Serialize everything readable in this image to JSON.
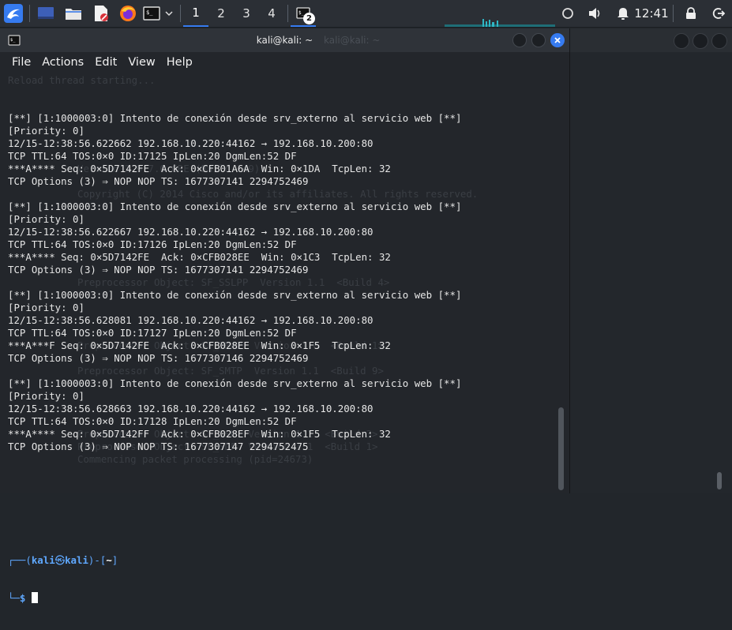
{
  "taskbar": {
    "workspaces": [
      "1",
      "2",
      "3",
      "4"
    ],
    "active_workspace": 0,
    "terminal_task_count": "2",
    "clock": "12:41"
  },
  "window": {
    "title": "kali@kali: ~",
    "background_title": "kali@kali: ~"
  },
  "menu": [
    "File",
    "Actions",
    "Edit",
    "View",
    "Help"
  ],
  "terminal": {
    "lines": [
      "[**] [1:1000003:0] Intento de conexión desde srv_externo al servicio web [**]",
      "[Priority: 0]",
      "12/15-12:38:56.622662 192.168.10.220:44162 → 192.168.10.200:80",
      "TCP TTL:64 TOS:0×0 ID:17125 IpLen:20 DgmLen:52 DF",
      "***A**** Seq: 0×5D7142FE  Ack: 0×CFB01A6A  Win: 0×1DA  TcpLen: 32",
      "TCP Options (3) ⇒ NOP NOP TS: 1677307141 2294752469",
      "",
      "[**] [1:1000003:0] Intento de conexión desde srv_externo al servicio web [**]",
      "[Priority: 0]",
      "12/15-12:38:56.622667 192.168.10.220:44162 → 192.168.10.200:80",
      "TCP TTL:64 TOS:0×0 ID:17126 IpLen:20 DgmLen:52 DF",
      "***A**** Seq: 0×5D7142FE  Ack: 0×CFB028EE  Win: 0×1C3  TcpLen: 32",
      "TCP Options (3) ⇒ NOP NOP TS: 1677307141 2294752469",
      "",
      "[**] [1:1000003:0] Intento de conexión desde srv_externo al servicio web [**]",
      "[Priority: 0]",
      "12/15-12:38:56.628081 192.168.10.220:44162 → 192.168.10.200:80",
      "TCP TTL:64 TOS:0×0 ID:17127 IpLen:20 DgmLen:52 DF",
      "***A***F Seq: 0×5D7142FE  Ack: 0×CFB028EE  Win: 0×1F5  TcpLen: 32",
      "TCP Options (3) ⇒ NOP NOP TS: 1677307146 2294752469",
      "",
      "[**] [1:1000003:0] Intento de conexión desde srv_externo al servicio web [**]",
      "[Priority: 0]",
      "12/15-12:38:56.628663 192.168.10.220:44162 → 192.168.10.200:80",
      "TCP TTL:64 TOS:0×0 ID:17128 IpLen:20 DgmLen:52 DF",
      "***A**** Seq: 0×5D7142FF  Ack: 0×CFB028EF  Win: 0×1F5  TcpLen: 32",
      "TCP Options (3) ⇒ NOP NOP TS: 1677307147 2294752475"
    ],
    "prompt": {
      "open": "┌──(",
      "user": "kali",
      "at": "㉿",
      "host": "kali",
      "close": ")-[",
      "path": "~",
      "end": "]",
      "line2": "└─",
      "symbol": "$"
    },
    "ghost_lines": [
      "Reload thread starting...",
      "Version 2.9.7.0 GRE (Build 149)",
      "Copyright (C) 2014 Cisco and/or its affiliates. All rights reserved.",
      "Preprocessor Object: SF_SSLPP  Version 1.1  <Build 4>",
      "Preprocessor Object: SF_IMAP  Version 1.0  <Build 1>",
      "Preprocessor Object: SF_SMTP  Version 1.1  <Build 9>",
      "Preprocessor Object: SF_SSH  Version 1.1  <Build 3>",
      "Preprocessor Object: SF_SDF  Version 1.1  <Build 1>",
      "Commencing packet processing (pid=24673)"
    ]
  },
  "colors": {
    "accent": "#367bf0",
    "prompt_blue": "#5fa8ff",
    "terminal_bg": "#23262b"
  }
}
